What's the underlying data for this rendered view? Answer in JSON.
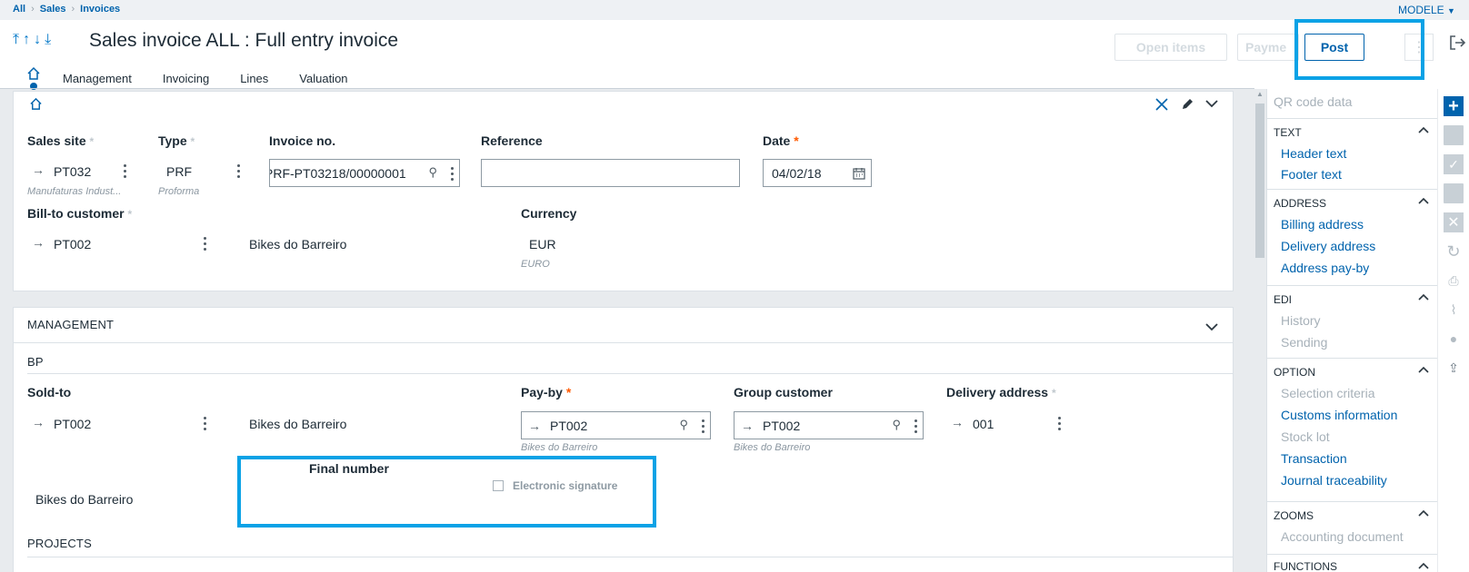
{
  "breadcrumb": {
    "items": [
      "All",
      "Sales",
      "Invoices"
    ]
  },
  "folder": "MODELE",
  "page_title": "Sales invoice ALL : Full entry invoice",
  "actions": {
    "open_items": "Open items",
    "payment": "Payme",
    "post": "Post",
    "more": "⋮"
  },
  "tabs": [
    "Management",
    "Invoicing",
    "Lines",
    "Valuation"
  ],
  "header_card": {
    "sales_site": {
      "label": "Sales site",
      "value": "PT032",
      "desc": "Manufaturas Indust..."
    },
    "type": {
      "label": "Type",
      "value": "PRF",
      "desc": "Proforma"
    },
    "invoice_no": {
      "label": "Invoice no.",
      "value": "PRF-PT03218/00000001"
    },
    "reference": {
      "label": "Reference",
      "value": ""
    },
    "date": {
      "label": "Date",
      "value": "04/02/18"
    },
    "bill_to": {
      "label": "Bill-to customer",
      "code": "PT002",
      "name": "Bikes do Barreiro"
    },
    "currency": {
      "label": "Currency",
      "value": "EUR",
      "desc": "EURO"
    }
  },
  "management": {
    "title": "MANAGEMENT",
    "bp_title": "BP",
    "sold_to": {
      "label": "Sold-to",
      "code": "PT002",
      "name": "Bikes do Barreiro"
    },
    "pay_by": {
      "label": "Pay-by",
      "value": "PT002",
      "desc": "Bikes do Barreiro"
    },
    "group_customer": {
      "label": "Group customer",
      "value": "PT002",
      "desc": "Bikes do Barreiro"
    },
    "delivery_address": {
      "label": "Delivery address",
      "value": "001"
    },
    "address_name": "Bikes do Barreiro",
    "final_number": {
      "label": "Final number"
    },
    "electronic_signature": "Electronic signature",
    "projects_title": "PROJECTS"
  },
  "right_panel": {
    "qr_placeholder": "QR code data",
    "sections": [
      {
        "title": "TEXT",
        "items": [
          {
            "label": "Header text",
            "enabled": true
          },
          {
            "label": "Footer text",
            "enabled": true
          }
        ]
      },
      {
        "title": "ADDRESS",
        "items": [
          {
            "label": "Billing address",
            "enabled": true
          },
          {
            "label": "Delivery address",
            "enabled": true
          },
          {
            "label": "Address pay-by",
            "enabled": true
          }
        ]
      },
      {
        "title": "EDI",
        "items": [
          {
            "label": "History",
            "enabled": false
          },
          {
            "label": "Sending",
            "enabled": false
          }
        ]
      },
      {
        "title": "OPTION",
        "items": [
          {
            "label": "Selection criteria",
            "enabled": false
          },
          {
            "label": "Customs information",
            "enabled": true
          },
          {
            "label": "Stock lot",
            "enabled": false
          },
          {
            "label": "Transaction",
            "enabled": true
          },
          {
            "label": "Journal traceability",
            "enabled": true
          }
        ]
      },
      {
        "title": "ZOOMS",
        "items": [
          {
            "label": "Accounting document",
            "enabled": false
          }
        ]
      },
      {
        "title": "FUNCTIONS",
        "items": []
      }
    ]
  },
  "colors": {
    "accent": "#0063ad",
    "highlight": "#0aa2e6",
    "required": "#ff5a00"
  }
}
